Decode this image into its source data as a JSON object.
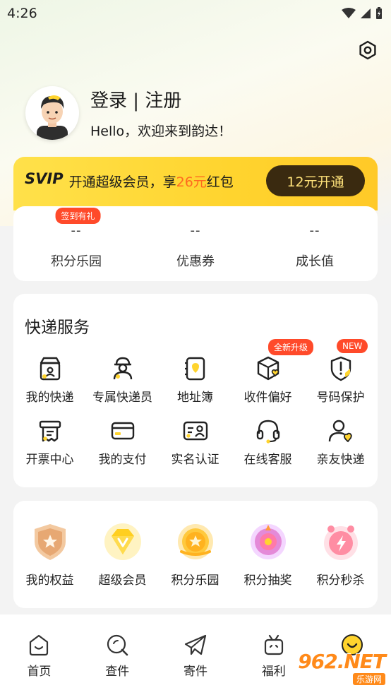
{
  "status": {
    "time": "4:26"
  },
  "profile": {
    "title": "登录 | 注册",
    "welcome": "Hello，欢迎来到韵达！"
  },
  "svip": {
    "tag": "SVIP",
    "text_before": "开通超级会员，享",
    "amount": "26元",
    "text_after": "红包",
    "button": "12元开通"
  },
  "stats": [
    {
      "value": "--",
      "label": "积分乐园",
      "badge": "签到有礼"
    },
    {
      "value": "--",
      "label": "优惠券"
    },
    {
      "value": "--",
      "label": "成长值"
    }
  ],
  "services": {
    "title": "快递服务",
    "items": [
      {
        "label": "我的快递",
        "icon": "package-icon"
      },
      {
        "label": "专属快递员",
        "icon": "courier-icon"
      },
      {
        "label": "地址簿",
        "icon": "address-book-icon"
      },
      {
        "label": "收件偏好",
        "icon": "box-heart-icon",
        "badge": "全新升级"
      },
      {
        "label": "号码保护",
        "icon": "shield-icon",
        "badge": "NEW"
      },
      {
        "label": "开票中心",
        "icon": "invoice-icon"
      },
      {
        "label": "我的支付",
        "icon": "card-icon"
      },
      {
        "label": "实名认证",
        "icon": "id-card-icon"
      },
      {
        "label": "在线客服",
        "icon": "headset-icon"
      },
      {
        "label": "亲友快递",
        "icon": "friend-icon"
      }
    ]
  },
  "benefits": [
    {
      "label": "我的权益",
      "icon": "rights-badge-icon"
    },
    {
      "label": "超级会员",
      "icon": "vip-diamond-icon"
    },
    {
      "label": "积分乐园",
      "icon": "points-coin-icon"
    },
    {
      "label": "积分抽奖",
      "icon": "lottery-icon"
    },
    {
      "label": "积分秒杀",
      "icon": "flash-sale-icon"
    }
  ],
  "tabs": [
    {
      "label": "首页",
      "icon": "home-icon"
    },
    {
      "label": "查件",
      "icon": "search-icon"
    },
    {
      "label": "寄件",
      "icon": "send-icon"
    },
    {
      "label": "福利",
      "icon": "gift-icon"
    },
    {
      "label": "",
      "icon": "smile-icon"
    }
  ],
  "watermark": {
    "main": "962.NET",
    "sub": "乐游网"
  },
  "colors": {
    "brand_yellow": "#ffd42e",
    "accent_orange": "#ff6a1f",
    "badge_red": "#ff4a2a"
  }
}
